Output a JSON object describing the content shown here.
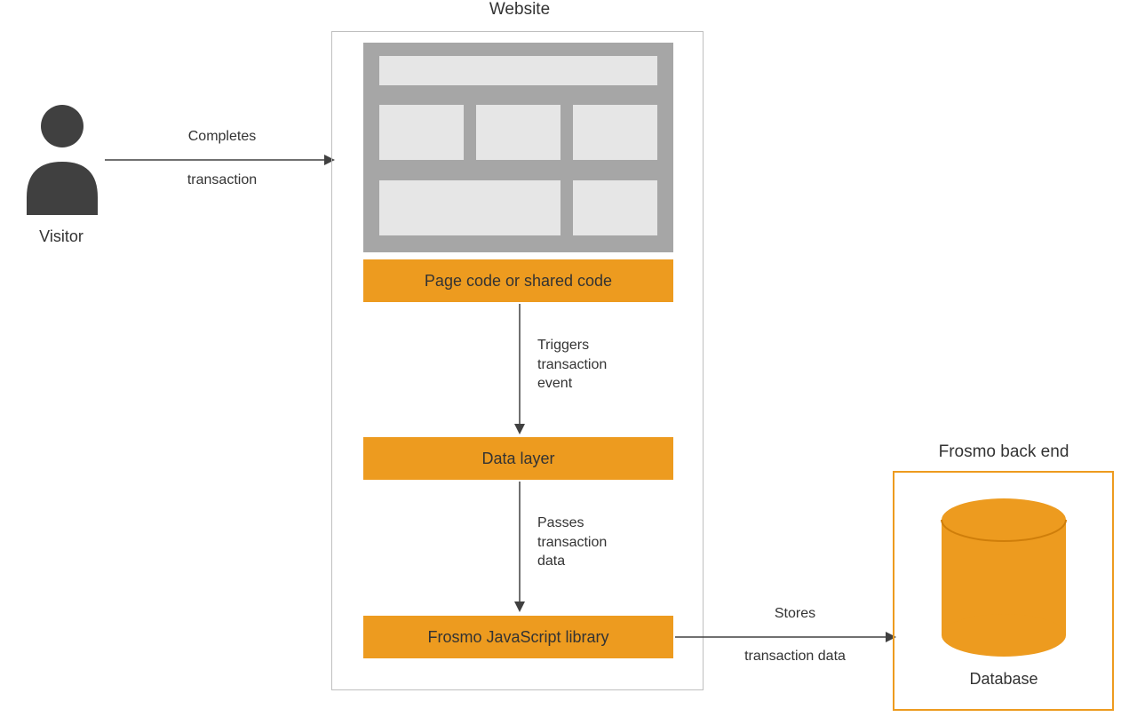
{
  "visitor": {
    "label": "Visitor"
  },
  "website": {
    "title": "Website"
  },
  "boxes": {
    "page_code": "Page code or shared code",
    "data_layer": "Data layer",
    "js_lib": "Frosmo JavaScript library"
  },
  "arrows": {
    "completes": {
      "line1": "Completes",
      "line2": "transaction"
    },
    "triggers": {
      "line1": "Triggers",
      "line2": "transaction",
      "line3": "event"
    },
    "passes": {
      "line1": "Passes",
      "line2": "transaction",
      "line3": "data"
    },
    "stores": {
      "line1": "Stores",
      "line2": "transaction data"
    }
  },
  "backend": {
    "title": "Frosmo back end",
    "database": "Database"
  }
}
